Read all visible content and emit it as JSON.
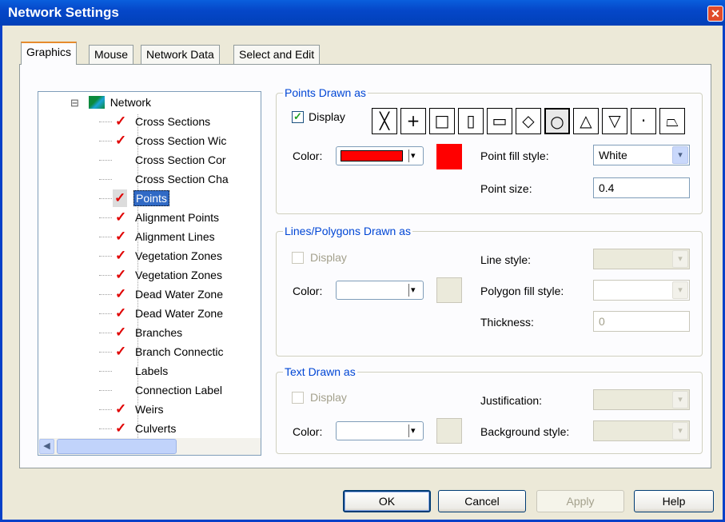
{
  "window": {
    "title": "Network Settings",
    "close_glyph": "✕"
  },
  "tabs": [
    {
      "label": "Graphics",
      "active": true
    },
    {
      "label": "Mouse",
      "active": false
    },
    {
      "label": "Network Data",
      "active": false
    },
    {
      "label": "Select and Edit",
      "active": false
    }
  ],
  "tree": {
    "expander": "⊟",
    "root_label": "Network",
    "root_icon": "network-icon",
    "items": [
      {
        "label": "Cross Sections",
        "checked": true,
        "selected": false
      },
      {
        "label": "Cross Section Wic",
        "checked": true,
        "selected": false
      },
      {
        "label": "Cross Section Cor",
        "checked": false,
        "selected": false
      },
      {
        "label": "Cross Section Cha",
        "checked": false,
        "selected": false
      },
      {
        "label": "Points",
        "checked": true,
        "selected": true
      },
      {
        "label": "Alignment Points",
        "checked": true,
        "selected": false
      },
      {
        "label": "Alignment Lines",
        "checked": true,
        "selected": false
      },
      {
        "label": "Vegetation Zones",
        "checked": true,
        "selected": false
      },
      {
        "label": "Vegetation Zones",
        "checked": true,
        "selected": false
      },
      {
        "label": "Dead Water Zone",
        "checked": true,
        "selected": false
      },
      {
        "label": "Dead Water Zone",
        "checked": true,
        "selected": false
      },
      {
        "label": "Branches",
        "checked": true,
        "selected": false
      },
      {
        "label": "Branch Connectic",
        "checked": true,
        "selected": false
      },
      {
        "label": "Labels",
        "checked": false,
        "selected": false
      },
      {
        "label": "Connection Label",
        "checked": false,
        "selected": false
      },
      {
        "label": "Weirs",
        "checked": true,
        "selected": false
      },
      {
        "label": "Culverts",
        "checked": true,
        "selected": false
      }
    ],
    "check_glyph": "✓",
    "scroll": {
      "up": "▲",
      "down": "▼",
      "left": "◀",
      "right": "▶"
    }
  },
  "points_group": {
    "title": "Points Drawn as",
    "display_label": "Display",
    "display_checked": true,
    "check_glyph": "✓",
    "color_label": "Color:",
    "color_value": "#ff0000",
    "arrow_glyph": "▾",
    "symbols": [
      "╳",
      "+",
      "□",
      "▯",
      "▭",
      "◇",
      "○",
      "△",
      "▽",
      "·",
      "⏢"
    ],
    "selected_symbol": 6,
    "fill_style_label": "Point fill style:",
    "fill_style_value": "White",
    "size_label": "Point size:",
    "size_value": "0.4"
  },
  "lines_group": {
    "title": "Lines/Polygons Drawn as",
    "display_label": "Display",
    "color_label": "Color:",
    "line_style_label": "Line style:",
    "polygon_fill_label": "Polygon fill style:",
    "thickness_label": "Thickness:",
    "thickness_value": "0"
  },
  "text_group": {
    "title": "Text Drawn as",
    "display_label": "Display",
    "color_label": "Color:",
    "justification_label": "Justification:",
    "background_label": "Background style:"
  },
  "buttons": {
    "ok": "OK",
    "cancel": "Cancel",
    "apply": "Apply",
    "help": "Help"
  },
  "colors": {
    "accent": "#0046d5",
    "check_red": "#e00000",
    "titlebar": "#0547c9"
  }
}
